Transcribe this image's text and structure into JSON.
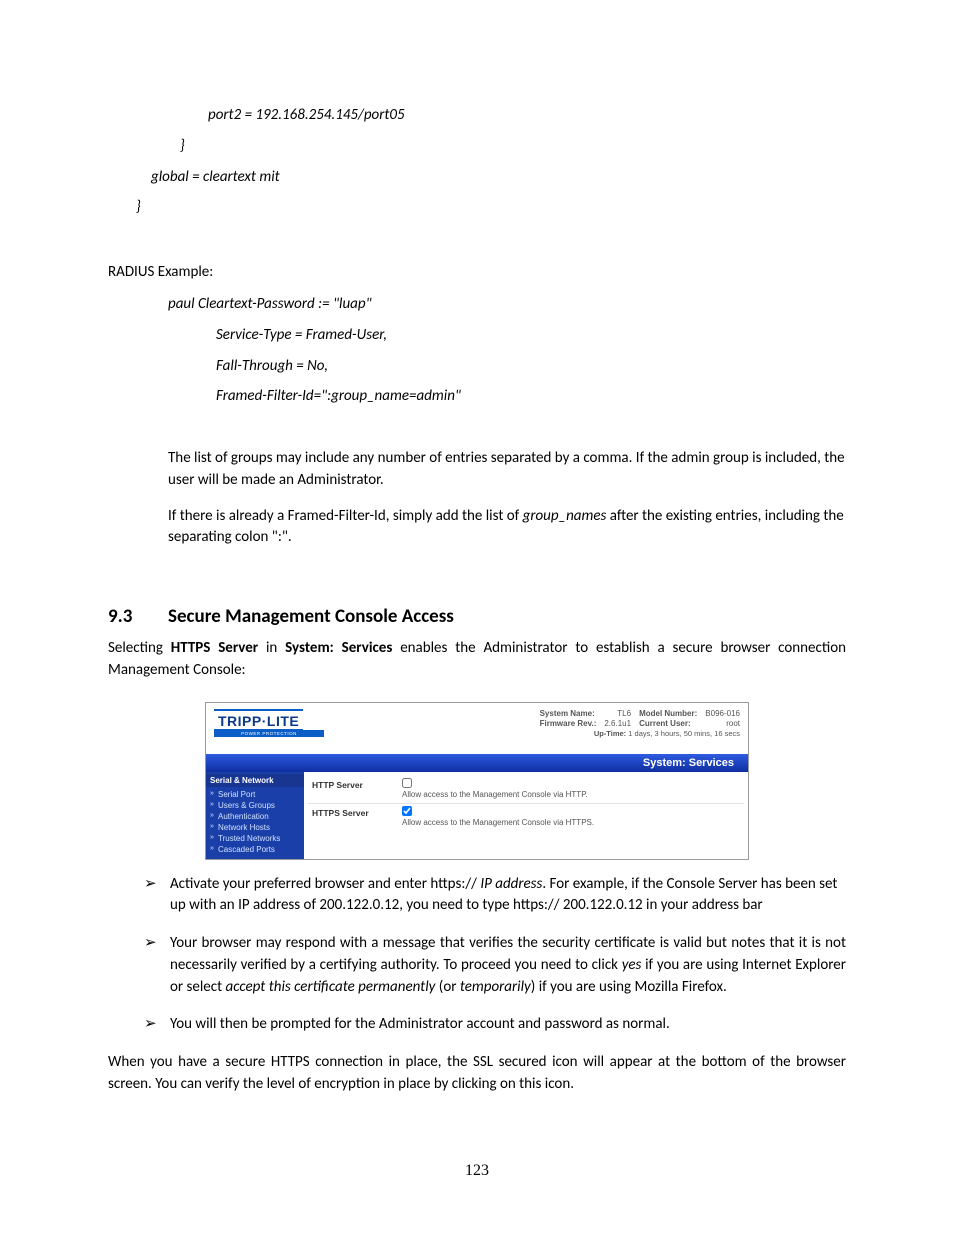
{
  "codeblock": {
    "line1": "port2 = 192.168.254.145/port05",
    "line2": "}",
    "line3": "global = cleartext mit",
    "line4": "}"
  },
  "radiusLabel": "RADIUS Example:",
  "radius": {
    "line1": "paul    Cleartext-Password := \"luap\"",
    "line2": "Service-Type = Framed-User,",
    "line3": "Fall-Through = No,",
    "line4": "Framed-Filter-Id=\":group_name=admin\""
  },
  "para1": "The list of groups may include any number of entries separated by a comma. If the admin group is included, the user will be made an Administrator.",
  "para2_a": "If there is already a Framed-Filter-Id, simply add the list of ",
  "para2_i": "group_names",
  "para2_b": " after the existing entries, including the separating colon \":\".",
  "heading_num": "9.3",
  "heading_txt": "Secure Management Console Access",
  "selecting_a": "Selecting ",
  "selecting_b": "HTTPS Server",
  "selecting_c": " in ",
  "selecting_d": "System: Services",
  "selecting_e": " enables the Administrator to establish a secure browser connection Management Console:",
  "figure": {
    "logo": "TRIPP·LITE",
    "logoSub": "POWER PROTECTION",
    "info": {
      "sysNameLbl": "System Name:",
      "sysNameVal": "TL6",
      "modelLbl": "Model Number:",
      "modelVal": "B096-016",
      "fwLbl": "Firmware Rev.:",
      "fwVal": "2.6.1u1",
      "userLbl": "Current User:",
      "userVal": "root",
      "uptime": "Up-Time: 1 days, 3 hours, 50 mins, 16 secs"
    },
    "barTitle": "System: Services",
    "side": {
      "header": "Serial & Network",
      "items": [
        "Serial Port",
        "Users & Groups",
        "Authentication",
        "Network Hosts",
        "Trusted Networks",
        "Cascaded Ports"
      ]
    },
    "rows": {
      "http": {
        "label": "HTTP Server",
        "desc": "Allow access to the Management Console via HTTP.",
        "checked": false
      },
      "https": {
        "label": "HTTPS Server",
        "desc": "Allow access to the Management Console via HTTPS.",
        "checked": true
      }
    }
  },
  "bullets": {
    "b1a": "Activate your preferred browser and enter https:// ",
    "b1i": "IP address",
    "b1b": ".  For  example, if the Console Server has been set up with an IP address of 200.122.0.12, you need to type https:// 200.122.0.12 in your address bar",
    "b2a": "Your browser may respond with a message that verifies the security certificate is valid but notes that it is not necessarily verified by a certifying authority. To proceed you need to click ",
    "b2i1": "yes",
    "b2b": " if you are using Internet Explorer or select ",
    "b2i2": "accept this certificate permanently",
    "b2c": " (or ",
    "b2i3": "temporarily",
    "b2d": ") if you are using Mozilla Firefox.",
    "b3": "You will then be prompted for the Administrator account and password as normal."
  },
  "closing": "When you have a secure HTTPS connection in place, the SSL secured icon will appear at the bottom of the browser screen. You can verify the level of encryption in place by clicking on this icon.",
  "pageNumber": "123"
}
